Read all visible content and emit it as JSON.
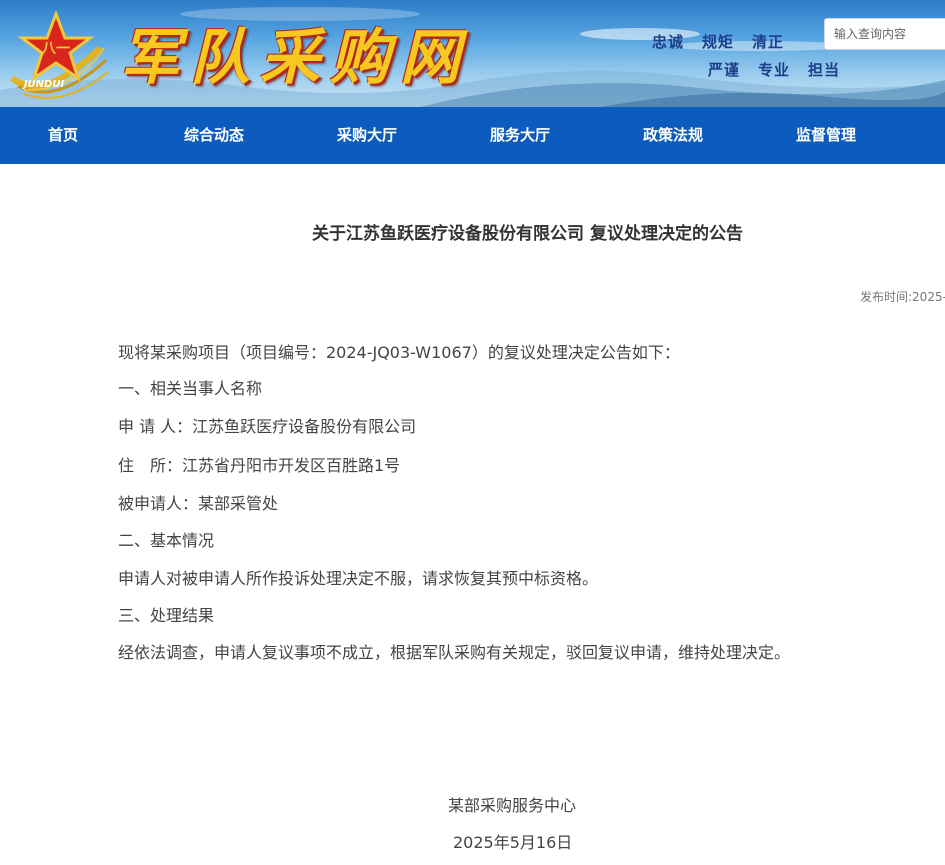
{
  "header": {
    "site_title": "军队采购网",
    "emblem_text": "JUNDUI",
    "emblem_star_text": "八一",
    "slogans_line1": [
      "忠诚",
      "规矩",
      "清正"
    ],
    "slogans_line2": [
      "严谨",
      "专业",
      "担当"
    ],
    "search": {
      "placeholder": "输入查询内容"
    }
  },
  "nav": {
    "items": [
      {
        "label": "首页"
      },
      {
        "label": "综合动态"
      },
      {
        "label": "采购大厅"
      },
      {
        "label": "服务大厅"
      },
      {
        "label": "政策法规"
      },
      {
        "label": "监督管理"
      }
    ]
  },
  "article": {
    "title": "关于江苏鱼跃医疗设备股份有限公司 复议处理决定的公告",
    "publish_time": "发布时间:2025-",
    "paragraphs": [
      "现将某采购项目（项目编号：2024-JQ03-W1067）的复议处理决定公告如下：",
      "一、相关当事人名称",
      "申 请 人：江苏鱼跃医疗设备股份有限公司",
      "住　所：江苏省丹阳市开发区百胜路1号",
      "被申请人：某部采管处",
      "二、基本情况",
      "申请人对被申请人所作投诉处理决定不服，请求恢复其预中标资格。",
      "三、处理结果",
      "经依法调查，申请人复议事项不成立，根据军队采购有关规定，驳回复议申请，维持处理决定。"
    ],
    "signature": "某部采购服务中心",
    "date": "2025年5月16日"
  },
  "colors": {
    "nav_bg": "#0b5cbe",
    "title_gold": "#f7c81f",
    "title_outline": "#b0261b",
    "slogan": "#1d3f8a"
  }
}
